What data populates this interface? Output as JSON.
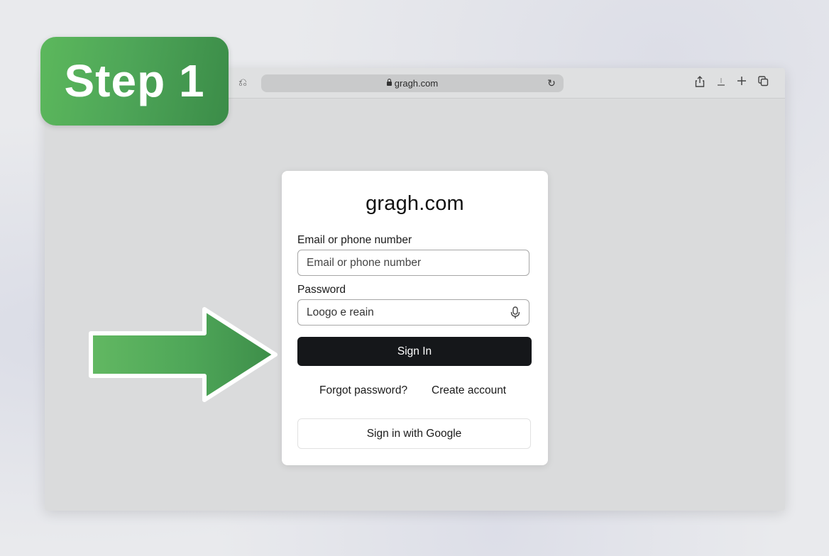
{
  "badge": {
    "text": "Step 1"
  },
  "browser": {
    "page_fragment": "g",
    "address_bar": {
      "url": "gragh.com"
    },
    "icons": {
      "back": "back-icon",
      "reload": "reload-icon",
      "share": "share-icon",
      "download": "download-icon",
      "new_tab": "plus-icon",
      "tabs": "tabs-icon",
      "lock": "lock-icon"
    }
  },
  "login": {
    "site_title": "gragh.com",
    "email": {
      "label": "Email or phone number",
      "placeholder": "Email or phone number"
    },
    "password": {
      "label": "Password",
      "value": "Loogo e reain"
    },
    "sign_in_label": "Sign In",
    "forgot_password": "Forgot password?",
    "create_account": "Create account",
    "google_sign_in": "Sign in with Google"
  },
  "colors": {
    "badge_green": "#4ea658",
    "arrow_green": "#4ea658",
    "highlight_green": "#5aa65e",
    "sign_in_button": "#15171a"
  }
}
